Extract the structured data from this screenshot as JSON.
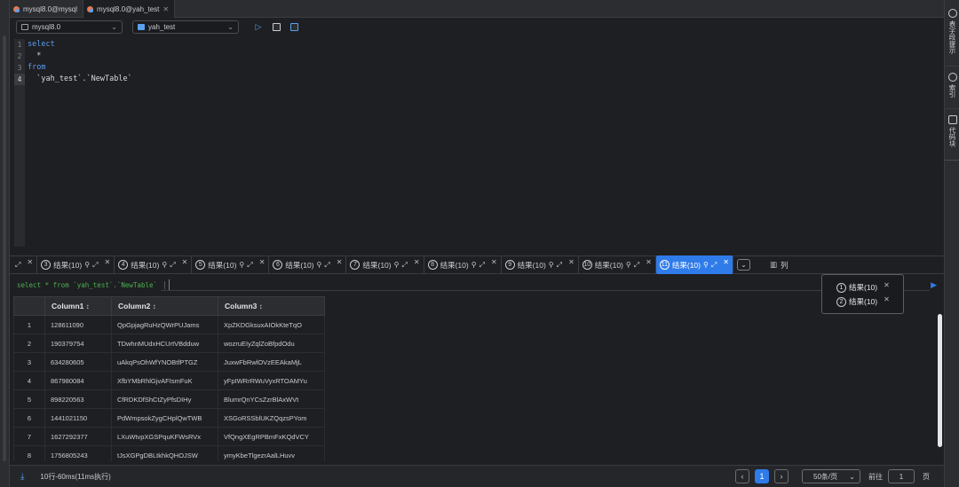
{
  "tabs": [
    {
      "label": "mysql8.0@mysql",
      "active": false
    },
    {
      "label": "mysql8.0@yah_test",
      "active": true
    }
  ],
  "toolbar": {
    "connection": "mysql8.0",
    "database": "yah_test",
    "icons": [
      "run-icon",
      "save-icon",
      "format-icon"
    ]
  },
  "editor": {
    "line_numbers": [
      "1",
      "2",
      "3",
      "4"
    ],
    "current_line": 4,
    "lines": [
      {
        "text": "select",
        "keyword": true
      },
      {
        "text": "  *",
        "keyword": false
      },
      {
        "text": "from",
        "keyword": true
      },
      {
        "text": "  `yah_test`.`NewTable`",
        "keyword": false
      }
    ]
  },
  "result_tabs": {
    "items": [
      {
        "num": "",
        "label": ""
      },
      {
        "num": "3",
        "label": "结果(10)"
      },
      {
        "num": "4",
        "label": "结果(10)"
      },
      {
        "num": "5",
        "label": "结果(10)"
      },
      {
        "num": "6",
        "label": "结果(10)"
      },
      {
        "num": "7",
        "label": "结果(10)"
      },
      {
        "num": "8",
        "label": "结果(10)"
      },
      {
        "num": "9",
        "label": "结果(10)"
      },
      {
        "num": "10",
        "label": "结果(10)"
      },
      {
        "num": "11",
        "label": "结果(10)"
      }
    ],
    "active_index": 9,
    "columns_label": "列"
  },
  "popup": {
    "items": [
      {
        "num": "1",
        "label": "结果(10)"
      },
      {
        "num": "2",
        "label": "结果(10)"
      }
    ]
  },
  "sql_strip": {
    "text": "select * from `yah_test`.`NewTable`"
  },
  "table": {
    "columns": [
      "Column1",
      "Column2",
      "Column3"
    ],
    "rows": [
      [
        "1",
        "128611090",
        "QpGpjagRuHzQWrPUJams",
        "XpZKDGksuxAIOkKteTqO"
      ],
      [
        "2",
        "190379754",
        "TDwhnMUdxHCUrtVBdduw",
        "wozruEIyZqlZoBfpdOdu"
      ],
      [
        "3",
        "634280605",
        "uAkqPsOhWfYNOBtfPTGZ",
        "JuxwFbRwlOVzEEAkaMjL"
      ],
      [
        "4",
        "867980084",
        "XfbYMbRhlGjvAFIsmFuK",
        "yFpIWRrRWuVyxRTOAMYu"
      ],
      [
        "5",
        "898220563",
        "CfRDKDfShCtZyPfsDIHy",
        "BlumrQnYCsZzrBlAxWVt"
      ],
      [
        "6",
        "1441021150",
        "PdWmpsokZygCHplQwTWB",
        "XSGoRSSblUKZQqzsPYom"
      ],
      [
        "7",
        "1627292377",
        "LXuWtvpXGSPquKFWsRVx",
        "VfQngXEgRPBmFxKQdVCY"
      ],
      [
        "8",
        "1756805243",
        "tJsXGPgDBLtkhkQHOJSW",
        "ymyKbeTlgezrAalLHuvv"
      ]
    ]
  },
  "status": {
    "text": "10行-60ms(11ms执行)",
    "current_page": "1",
    "page_size": "50条/页",
    "goto_label": "前往",
    "goto_value": "1",
    "page_suffix": "页"
  },
  "rail": {
    "items": [
      {
        "label": "表字段提示",
        "icon": "lightbulb-icon"
      },
      {
        "label": "索引",
        "icon": "index-icon"
      },
      {
        "label": "代码块",
        "icon": "code-block-icon"
      }
    ]
  },
  "colors": {
    "accent": "#2f7bea",
    "keyword": "#5b9bf0",
    "sql_green": "#4caf50",
    "background": "#1e1f22"
  }
}
